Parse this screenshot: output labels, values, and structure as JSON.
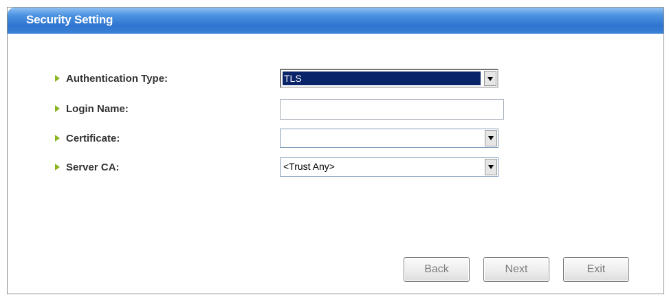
{
  "header": {
    "title": "Security Setting"
  },
  "fields": {
    "authentication_type": {
      "label": "Authentication Type:",
      "value": "TLS"
    },
    "login_name": {
      "label": "Login Name:",
      "value": ""
    },
    "certificate": {
      "label": "Certificate:",
      "value": ""
    },
    "server_ca": {
      "label": "Server CA:",
      "value": "<Trust Any>"
    }
  },
  "buttons": {
    "back": "Back",
    "next": "Next",
    "exit": "Exit"
  },
  "colors": {
    "header_blue": "#2f74cf",
    "bullet_green": "#8ab623",
    "selection_navy": "#0a246a"
  }
}
